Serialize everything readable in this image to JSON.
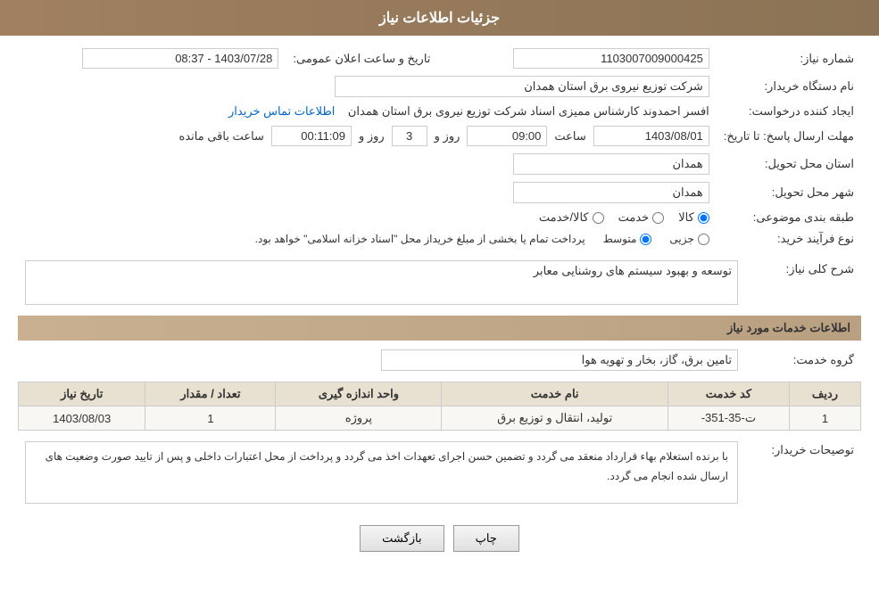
{
  "header": {
    "title": "جزئیات اطلاعات نیاز"
  },
  "fields": {
    "need_number_label": "شماره نیاز:",
    "need_number_value": "1103007009000425",
    "buyer_org_label": "نام دستگاه خریدار:",
    "buyer_org_value": "شرکت توزیع نیروی برق استان همدان",
    "creator_label": "ایجاد کننده درخواست:",
    "creator_value": "افسر احمدوند کارشناس ممیزی اسناد شرکت توزیع نیروی برق استان همدان",
    "creator_link": "اطلاعات تماس خریدار",
    "date_label": "تاریخ و ساعت اعلان عمومی:",
    "date_value": "1403/07/28 - 08:37",
    "response_deadline_label": "مهلت ارسال پاسخ: تا تاریخ:",
    "deadline_date": "1403/08/01",
    "deadline_time_label": "ساعت",
    "deadline_time": "09:00",
    "deadline_days_label": "روز و",
    "deadline_days": "3",
    "deadline_remaining_label": "ساعت باقی مانده",
    "deadline_remaining": "00:11:09",
    "province_label": "استان محل تحویل:",
    "province_value": "همدان",
    "city_label": "شهر محل تحویل:",
    "city_value": "همدان",
    "category_label": "طبقه بندی موضوعی:",
    "category_options": [
      "کالا",
      "خدمت",
      "کالا/خدمت"
    ],
    "category_selected": "کالا",
    "purchase_type_label": "نوع فرآیند خرید:",
    "purchase_type_options": [
      "جزیی",
      "متوسط"
    ],
    "purchase_type_selected": "متوسط",
    "purchase_note": "پرداخت تمام یا بخشی از مبلغ خریداز محل \"اسناد خزانه اسلامی\" خواهد بود.",
    "need_description_label": "شرح کلی نیاز:",
    "need_description_value": "توسعه و بهبود سیستم های روشنایی معابر"
  },
  "services_section": {
    "title": "اطلاعات خدمات مورد نیاز",
    "service_group_label": "گروه خدمت:",
    "service_group_value": "تامین برق، گاز، بخار و تهویه هوا",
    "table": {
      "columns": [
        "ردیف",
        "کد خدمت",
        "نام خدمت",
        "واحد اندازه گیری",
        "تعداد / مقدار",
        "تاریخ نیاز"
      ],
      "rows": [
        {
          "row_num": "1",
          "service_code": "ت-35-351-",
          "service_name": "تولید، انتقال و توزیع برق",
          "unit": "پروژه",
          "quantity": "1",
          "date": "1403/08/03"
        }
      ]
    }
  },
  "buyer_notes_label": "توصیحات خریدار:",
  "buyer_notes_value": "با برنده استعلام بهاء قرارداد منعقد می گردد و تضمین حسن اجرای تعهدات اخذ می گردد و پرداخت از محل اعتبارات داخلی و پس از تایید صورت وضعیت های ارسال شده انجام می گردد.",
  "buttons": {
    "back_label": "بازگشت",
    "print_label": "چاپ"
  }
}
